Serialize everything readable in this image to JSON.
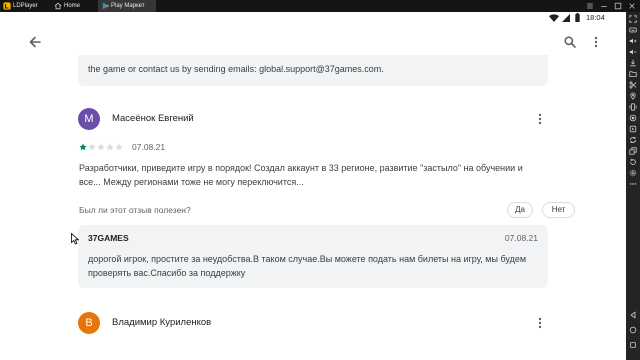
{
  "emulator": {
    "brand": "LDPlayer",
    "tabs": [
      {
        "label": "Home",
        "icon": "home-tab-icon"
      },
      {
        "label": "Play Маркет",
        "icon": "play-store-icon",
        "active": true
      }
    ],
    "window_controls": [
      "menu-icon",
      "minimize-icon",
      "maximize-icon",
      "close-icon"
    ],
    "sidebar_tools": [
      "fullscreen-icon",
      "keyboard-mapping-icon",
      "volume-up-icon",
      "volume-down-icon",
      "install-apk-icon",
      "shared-folder-icon",
      "screenshot-icon",
      "location-icon",
      "shake-icon",
      "record-video-icon",
      "operation-recorder-icon",
      "sync-icon",
      "multi-instance-icon",
      "rotate-icon",
      "settings-icon",
      "more-tools-icon"
    ],
    "sidebar_nav": [
      "back-nav-icon",
      "home-nav-icon",
      "recent-apps-icon"
    ]
  },
  "status_bar": {
    "icons": [
      "wifi-icon",
      "signal-icon",
      "battery-icon"
    ],
    "time": "18:04"
  },
  "app_bar": {
    "icons": [
      "back-arrow-icon",
      "search-icon",
      "more-options-icon"
    ]
  },
  "previous_reply": {
    "text": "the game or contact us by sending emails: global.support@37games.com."
  },
  "reviews": [
    {
      "avatar_letter": "М",
      "avatar_color": "#6c4ea8",
      "author": "Масеёнок Евгений",
      "rating": 1,
      "rating_max": 5,
      "date": "07.08.21",
      "text": "Разработчики, приведите игру в порядок! Создал аккаунт в 33 регионе, развитие \"застыло\" на обучении и все... Между регионами тоже не могу переключится...",
      "helpful_prompt": "Был ли этот отзыв полезен?",
      "helpful_yes": "Да",
      "helpful_no": "Нет",
      "developer_reply": {
        "developer": "37GAMES",
        "date": "07.08.21",
        "text": "дорогой игрок, простите за неудобства.В таком случае.Вы можете подать нам билеты на игру, мы будем проверять вас.Спасибо за поддержку"
      }
    },
    {
      "avatar_letter": "В",
      "avatar_color": "#e8750c",
      "author": "Владимир Куриленков"
    }
  ],
  "colors": {
    "star_filled": "#01875f",
    "star_empty": "#dadce0",
    "reply_background": "#f1f3f4"
  }
}
